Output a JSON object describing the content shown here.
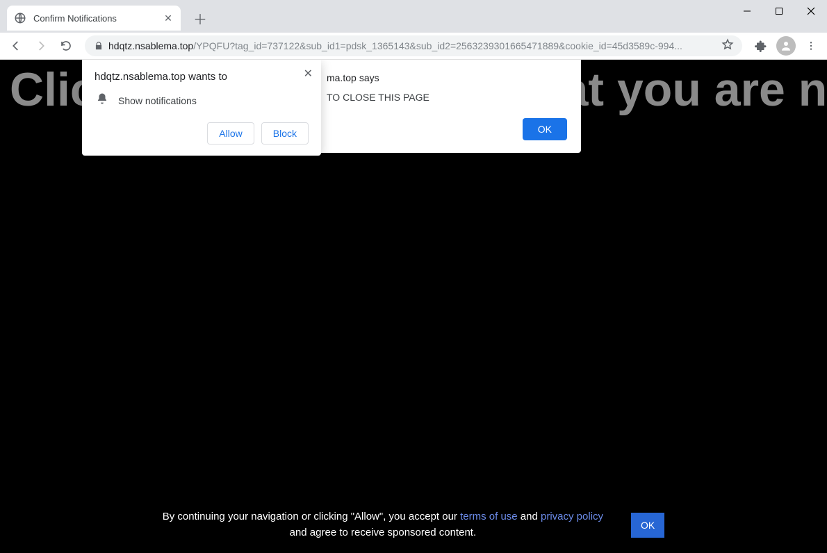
{
  "tab": {
    "title": "Confirm Notifications"
  },
  "url": {
    "domain": "hdqtz.nsablema.top",
    "path": "/YPQFU?tag_id=737122&sub_id1=pdsk_1365143&sub_id2=2563239301665471889&cookie_id=45d3589c-994..."
  },
  "page": {
    "headline": "Click Allow to confirm that you are not"
  },
  "permission": {
    "site": "hdqtz.nsablema.top",
    "verb": "wants to",
    "capability": "Show notifications",
    "allow": "Allow",
    "block": "Block"
  },
  "alert": {
    "site_suffix": "ma.top",
    "says": "says",
    "message_suffix": "TO CLOSE THIS PAGE",
    "ok": "OK"
  },
  "cookie": {
    "line1_prefix": "By continuing your navigation or clicking \"Allow\", you accept our ",
    "terms": "terms of use",
    "and": " and ",
    "privacy": "privacy policy",
    "line2": "and agree to receive sponsored content.",
    "ok": "OK"
  }
}
